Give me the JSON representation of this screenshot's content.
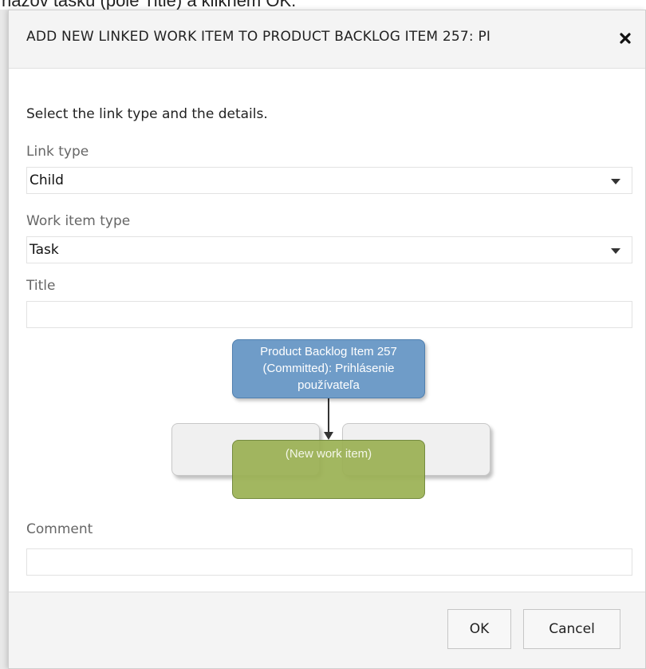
{
  "background": {
    "partial_text": "nazov tasku (pole Title) a kliknem OK."
  },
  "dialog": {
    "title": "ADD NEW LINKED WORK ITEM TO PRODUCT BACKLOG ITEM 257: PI",
    "close_icon": "close-icon",
    "instruction": "Select the link type and the details."
  },
  "fields": {
    "link_type": {
      "label": "Link type",
      "value": "Child"
    },
    "work_item_type": {
      "label": "Work item type",
      "value": "Task"
    },
    "title": {
      "label": "Title",
      "value": "",
      "placeholder": ""
    },
    "comment": {
      "label": "Comment",
      "value": "",
      "placeholder": ""
    }
  },
  "diagram": {
    "parent_node_text": "Product Backlog Item 257 (Committed): Prihlásenie používateľa",
    "new_node_text": "(New work item)",
    "colors": {
      "parent": "#6f9cc8",
      "new_item": "#9bb153",
      "sibling": "#f0f0f0"
    }
  },
  "buttons": {
    "ok": "OK",
    "cancel": "Cancel"
  }
}
